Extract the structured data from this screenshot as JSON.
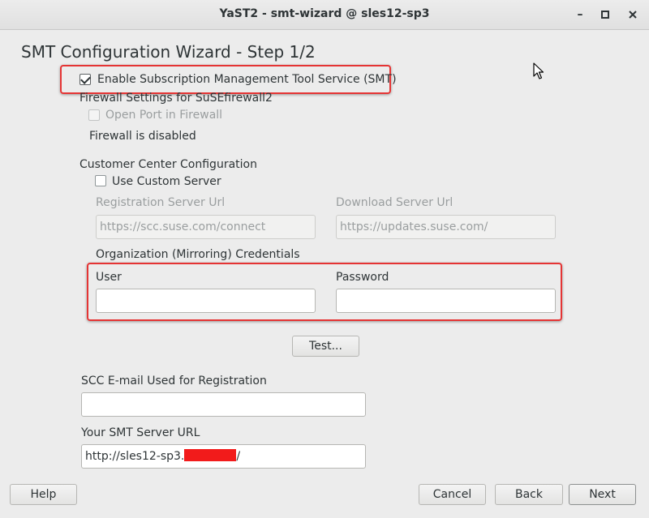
{
  "window": {
    "title": "YaST2 - smt-wizard @ sles12-sp3",
    "minimize_glyph": "–",
    "maximize_glyph": "□",
    "close_glyph": "✕"
  },
  "wizard": {
    "title": "SMT Configuration Wizard - Step 1/2"
  },
  "smt": {
    "enable_label": "Enable Subscription Management Tool Service (SMT)",
    "enable_checked": true
  },
  "firewall": {
    "heading": "Firewall Settings for SuSEfirewall2",
    "open_port_label": "Open Port in Firewall",
    "status": "Firewall is disabled"
  },
  "customer_center": {
    "heading": "Customer Center Configuration",
    "use_custom_server_label": "Use Custom Server",
    "registration_url_label": "Registration Server Url",
    "registration_url_value": "https://scc.suse.com/connect",
    "download_url_label": "Download Server Url",
    "download_url_value": "https://updates.suse.com/"
  },
  "credentials": {
    "heading": "Organization (Mirroring) Credentials",
    "user_label": "User",
    "user_value": "",
    "password_label": "Password",
    "password_value": ""
  },
  "test_button": "Test...",
  "scc_email": {
    "label": "SCC E-mail Used for Registration",
    "value": ""
  },
  "smt_server_url": {
    "label": "Your SMT Server URL",
    "value_prefix": "http://sles12-sp3.",
    "value_suffix": "/"
  },
  "footer": {
    "help": "Help",
    "cancel": "Cancel",
    "back": "Back",
    "next": "Next"
  },
  "colors": {
    "highlight": "#e53434",
    "redaction": "#f21b1b",
    "window_bg": "#ececec"
  }
}
